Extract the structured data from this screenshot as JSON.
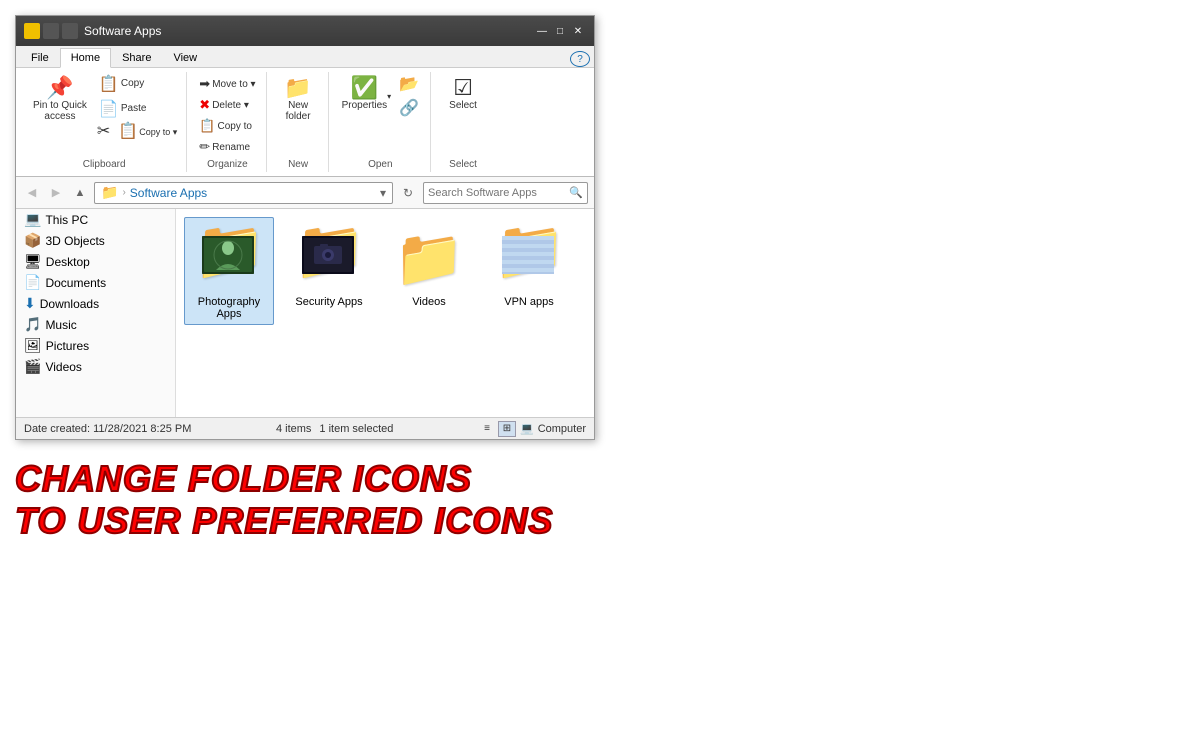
{
  "window": {
    "title": "Software Apps",
    "titlebar_icons": [
      "yellow",
      "dark",
      "dark"
    ],
    "controls": [
      "—",
      "□",
      "✕"
    ]
  },
  "tabs": [
    {
      "label": "File",
      "active": false
    },
    {
      "label": "Home",
      "active": true
    },
    {
      "label": "Share",
      "active": false
    },
    {
      "label": "View",
      "active": false
    }
  ],
  "ribbon": {
    "groups": [
      {
        "label": "Clipboard",
        "buttons": [
          {
            "icon": "📌",
            "label": "Pin to Quick\naccess"
          },
          {
            "icon": "📋",
            "label": "Copy"
          },
          {
            "icon": "📄",
            "label": "Paste"
          }
        ],
        "rows": [
          {
            "icon": "✂",
            "label": "Cut"
          },
          {
            "icon": "📋",
            "label": "Copy to"
          },
          {
            "icon": "📋",
            "label": "Copy to"
          }
        ]
      },
      {
        "label": "Organize",
        "rows": [
          {
            "icon": "➡",
            "label": "Move to"
          },
          {
            "icon": "✖",
            "label": "Delete"
          },
          {
            "icon": "📋",
            "label": "Copy to"
          },
          {
            "icon": "✏",
            "label": "Rename"
          }
        ]
      },
      {
        "label": "New",
        "buttons": [
          {
            "icon": "📁",
            "label": "New\nfolder"
          }
        ]
      },
      {
        "label": "Open",
        "buttons": [
          {
            "icon": "🔍",
            "label": "Properties"
          },
          {
            "icon": "📂",
            "label": ""
          },
          {
            "icon": "🔗",
            "label": ""
          }
        ]
      },
      {
        "label": "Select",
        "buttons": [
          {
            "icon": "☑",
            "label": "Select"
          }
        ]
      }
    ]
  },
  "addressbar": {
    "back_disabled": true,
    "forward_disabled": true,
    "up_enabled": true,
    "breadcrumb": [
      "Software Apps"
    ],
    "search_placeholder": "Search Software Apps"
  },
  "sidebar": {
    "items": [
      {
        "icon": "💻",
        "label": "This PC",
        "selected": false
      },
      {
        "icon": "📦",
        "label": "3D Objects",
        "selected": false
      },
      {
        "icon": "🖥",
        "label": "Desktop",
        "selected": false
      },
      {
        "icon": "📄",
        "label": "Documents",
        "selected": false
      },
      {
        "icon": "⬇",
        "label": "Downloads",
        "selected": false
      },
      {
        "icon": "🎵",
        "label": "Music",
        "selected": false
      },
      {
        "icon": "🖼",
        "label": "Pictures",
        "selected": false
      },
      {
        "icon": "🎬",
        "label": "Videos",
        "selected": false
      }
    ]
  },
  "files": [
    {
      "name": "Photography\nApps",
      "type": "photo-custom",
      "selected": true
    },
    {
      "name": "Security Apps",
      "type": "security-custom",
      "selected": false
    },
    {
      "name": "Videos",
      "type": "plain",
      "selected": false
    },
    {
      "name": "VPN apps",
      "type": "vpn-custom",
      "selected": false
    }
  ],
  "statusbar": {
    "items_count": "4 items",
    "selected": "1 item selected",
    "date_label": "Date created:",
    "date_value": "11/28/2021 8:25 PM",
    "computer_label": "Computer"
  },
  "bottom": {
    "line1": "CHANGE FOLDER ICONS",
    "line2": "TO USER PREFERRED ICONS"
  }
}
